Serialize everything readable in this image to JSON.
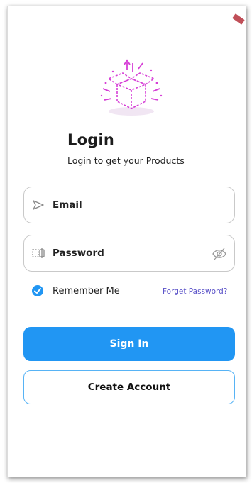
{
  "login": {
    "title": "Login",
    "subtitle": "Login to get your Products"
  },
  "fields": {
    "email_placeholder": "Email",
    "password_placeholder": "Password"
  },
  "options": {
    "remember_label": "Remember Me",
    "remember_checked": true,
    "forgot_label": "Forget Password?"
  },
  "buttons": {
    "sign_in": "Sign In",
    "create_account": "Create Account"
  },
  "colors": {
    "accent": "#2196f3",
    "link": "#5a52c8",
    "illustration": "#d63fd6"
  }
}
